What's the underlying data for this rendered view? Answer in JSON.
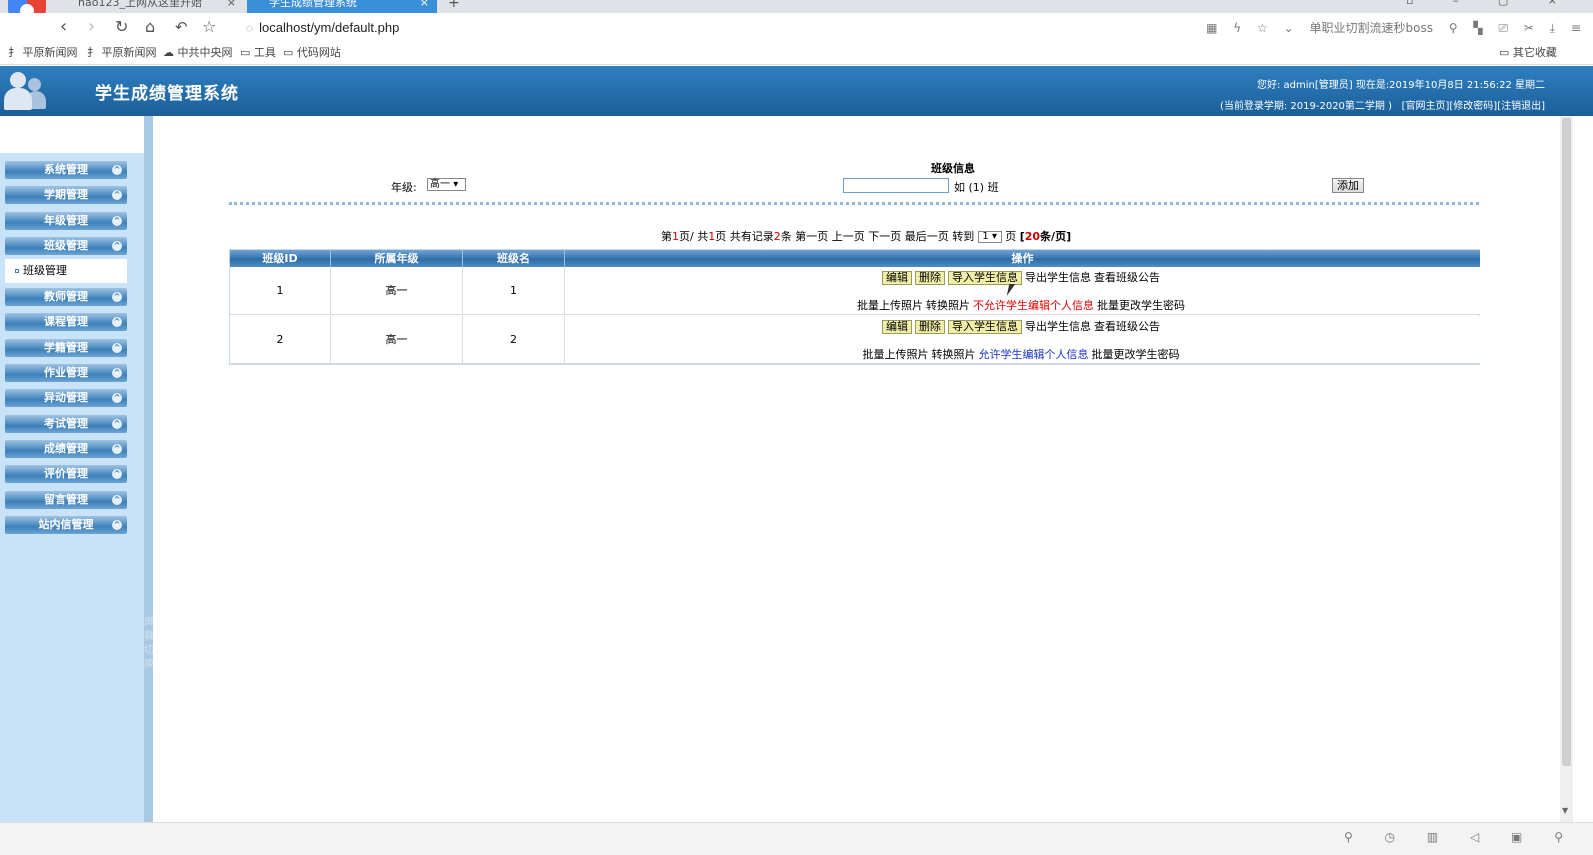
{
  "browser": {
    "tabs": [
      {
        "label": "hao123_上网从这里开始",
        "close": "×"
      },
      {
        "label": "学生成绩管理系统",
        "close": "×"
      }
    ],
    "new_tab": "+",
    "url": "localhost/ym/default.php",
    "right_ext": "单职业切割流速秒boss",
    "bookmarks": [
      "平原新闻网",
      "平原新闻网",
      "中共中央网",
      "工具",
      "代码网站"
    ],
    "other_bookmarks": "其它收藏"
  },
  "header": {
    "system_name": "学生成绩管理系统",
    "greeting": "您好: admin[管理员] 现在是:2019年10月8日 21:56:22 星期二",
    "term_info": "(当前登录学期: 2019-2020第二学期 )",
    "links": [
      "[官网主页]",
      "[修改密码]",
      "[注销退出]"
    ]
  },
  "sidebar": {
    "menus": [
      "系统管理",
      "学期管理",
      "年级管理",
      "班级管理",
      "教师管理",
      "课程管理",
      "学籍管理",
      "作业管理",
      "异动管理",
      "考试管理",
      "成绩管理",
      "评价管理",
      "留言管理",
      "站内信管理"
    ],
    "active_submenu": "班级管理",
    "divider_label": "屏幕切换",
    "chevron": "^"
  },
  "form": {
    "title": "班级信息",
    "grade_label": "年级:",
    "grade_value": "高一",
    "hint": "如 (1) 班",
    "add_label": "添加"
  },
  "pager": {
    "prefix": "第",
    "current": "1",
    "page_sep": "页/ 共",
    "total_pages": "1",
    "records_label": "页 共有记录",
    "records": "2",
    "records_unit": "条",
    "first": "第一页",
    "prev": "上一页",
    "next": "下一页",
    "last": "最后一页",
    "goto": "转到",
    "goto_value": "1",
    "page_unit": "页",
    "per_page_open": "[",
    "per_page": "20",
    "per_page_unit": "条/页]"
  },
  "table": {
    "headers": [
      "班级ID",
      "所属年级",
      "班级名",
      "操作"
    ],
    "rows": [
      {
        "id": "1",
        "grade": "高一",
        "name": "1",
        "edit_toggle": "不允许学生编辑个人信息",
        "toggle_color": "#e00000"
      },
      {
        "id": "2",
        "grade": "高一",
        "name": "2",
        "edit_toggle": "允许学生编辑个人信息",
        "toggle_color": "#1a35c8"
      }
    ],
    "actions": {
      "edit": "编辑",
      "delete": "删除",
      "import": "导入学生信息",
      "export": "导出学生信息",
      "notice": "查看班级公告",
      "batch_photo": "批量上传照片",
      "convert_photo": "转换照片",
      "batch_password": "批量更改学生密码"
    }
  },
  "colors": {
    "header_blue": "#1b5f99",
    "sidebar_bg": "#c8e3f7",
    "button_yellow": "#f0eea8",
    "red_link": "#e00000",
    "blue_link": "#1a35c8"
  }
}
